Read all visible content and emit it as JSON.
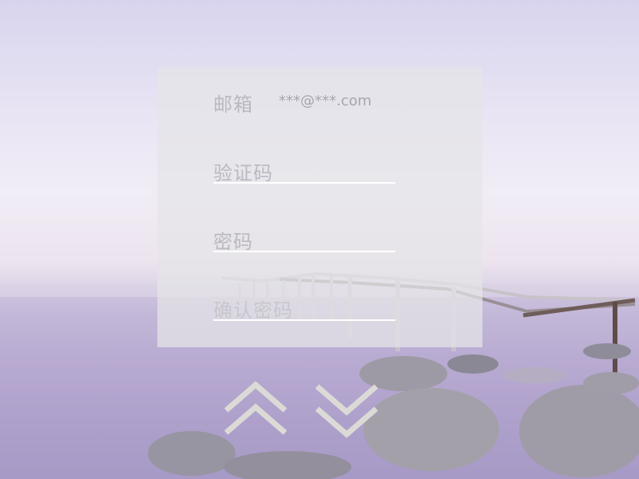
{
  "form": {
    "email_label": "邮箱",
    "email_value": "***@***.com",
    "code_label": "验证码",
    "password_label": "密码",
    "confirm_password_label": "确认密码"
  },
  "navigation": {
    "up_icon": "double-chevron-up-icon",
    "down_icon": "double-chevron-down-icon"
  },
  "colors": {
    "panel": "#e4e4e8",
    "label": "#b9b9bf",
    "underline": "#ffffff",
    "arrow": "#dcdad6"
  }
}
